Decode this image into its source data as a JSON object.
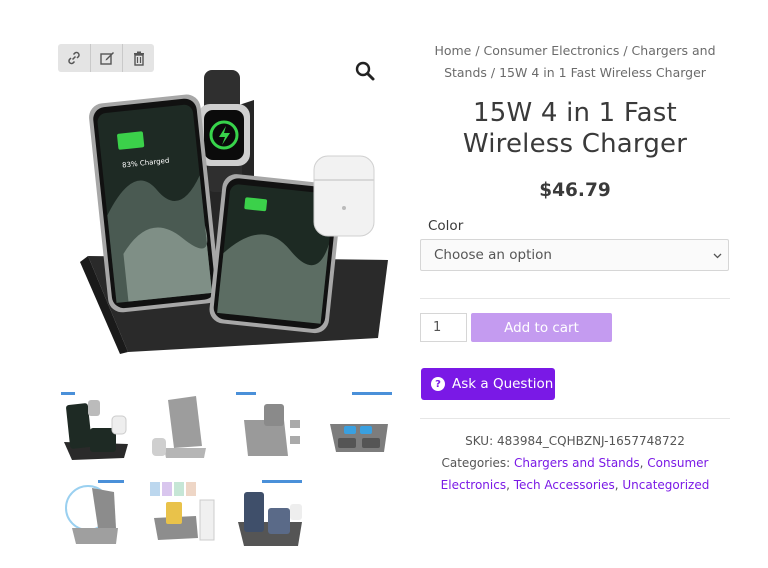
{
  "toolbar": {
    "icons": [
      "link-icon",
      "edit-icon",
      "trash-icon"
    ]
  },
  "breadcrumb": {
    "items": [
      "Home",
      "Consumer Electronics",
      "Chargers and Stands",
      "15W 4 in 1 Fast Wireless Charger"
    ],
    "separator": " / "
  },
  "product": {
    "title": "15W 4 in 1 Fast Wireless Charger",
    "price": "$46.79"
  },
  "variation": {
    "label": "Color",
    "placeholder": "Choose an option"
  },
  "cart": {
    "quantity": "1",
    "add_label": "Add to cart"
  },
  "ask": {
    "label": "Ask a Question"
  },
  "meta": {
    "sku_label": "SKU:",
    "sku": "483984_CQHBZNJ-1657748722",
    "categories_label": "Categories:",
    "categories": [
      "Chargers and Stands",
      "Consumer Electronics",
      "Tech Accessories",
      "Uncategorized"
    ]
  },
  "main_image": {
    "phone_screen_text": "83% Charged"
  },
  "colors": {
    "accent": "#7a19e6",
    "button_disabled": "#c49bf0"
  }
}
